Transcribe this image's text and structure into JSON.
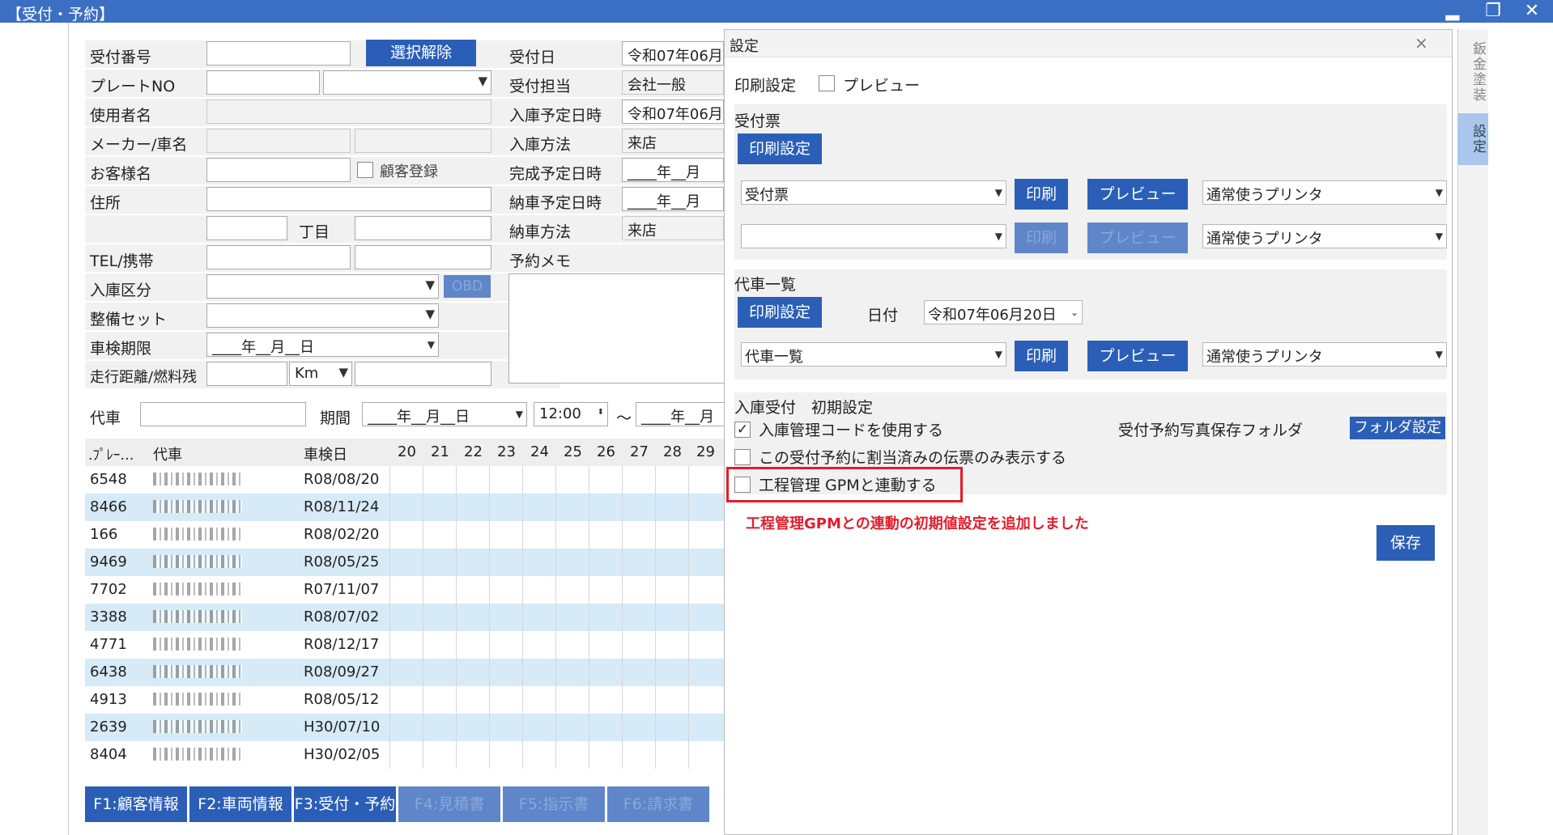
{
  "window": {
    "title": "【受付・予約】",
    "minimize": "▂",
    "restore": "❐",
    "close": "✕"
  },
  "form": {
    "reception_no_label": "受付番号",
    "clear_selection_button": "選択解除",
    "plate_label": "プレートNO",
    "user_label": "使用者名",
    "maker_label": "メーカー/車名",
    "customer_label": "お客様名",
    "customer_register_label": "顧客登録",
    "address_label": "住所",
    "chome_label": "丁目",
    "tel_label": "TEL/携帯",
    "arrival_type_label": "入庫区分",
    "obd_button": "OBD",
    "service_set_label": "整備セット",
    "inspection_label": "車検期限",
    "inspection_value": "____年__月__日",
    "mileage_label": "走行距離/燃料残",
    "mileage_unit": "Km",
    "right": {
      "date_label": "受付日",
      "date_value": "令和07年06月",
      "staff_label": "受付担当",
      "staff_value": "会社一般",
      "arrival_dt_label": "入庫予定日時",
      "arrival_dt_value": "令和07年06月",
      "arrival_method_label": "入庫方法",
      "arrival_method_value": "来店",
      "complete_dt_label": "完成予定日時",
      "complete_dt_value": "____年__月",
      "delivery_dt_label": "納車予定日時",
      "delivery_dt_value": "____年__月",
      "delivery_method_label": "納車方法",
      "delivery_method_value": "来店",
      "memo_label": "予約メモ"
    },
    "loaner_label": "代車",
    "period_label": "期間",
    "period_from": "____年__月__日",
    "period_time": "12:00",
    "period_tilde": "〜",
    "period_to": "____年__月"
  },
  "grid": {
    "headers": {
      "plate": ".ﾌﾟﾚｰ…",
      "car": "代車",
      "inspection": "車検日"
    },
    "days": [
      "20",
      "21",
      "22",
      "23",
      "24",
      "25",
      "26",
      "27",
      "28",
      "29"
    ],
    "rows": [
      {
        "plate": "6548",
        "date": "R08/08/20"
      },
      {
        "plate": "8466",
        "date": "R08/11/24"
      },
      {
        "plate": "166",
        "date": "R08/02/20"
      },
      {
        "plate": "9469",
        "date": "R08/05/25"
      },
      {
        "plate": "7702",
        "date": "R07/11/07"
      },
      {
        "plate": "3388",
        "date": "R08/07/02"
      },
      {
        "plate": "4771",
        "date": "R08/12/17"
      },
      {
        "plate": "6438",
        "date": "R08/09/27"
      },
      {
        "plate": "4913",
        "date": "R08/05/12"
      },
      {
        "plate": "2639",
        "date": "H30/07/10"
      },
      {
        "plate": "8404",
        "date": "H30/02/05"
      }
    ]
  },
  "fkeys": [
    "F1:顧客情報",
    "F2:車両情報",
    "F3:受付・予約",
    "F4:見積書",
    "F5:指示書",
    "F6:請求書"
  ],
  "settings": {
    "title": "設定",
    "close": "×",
    "print_settings_label": "印刷設定",
    "preview_label": "プレビュー",
    "receipt": {
      "title": "受付票",
      "print_settings_button": "印刷設定",
      "doc_select": "受付票",
      "print_button": "印刷",
      "preview_button": "プレビュー",
      "printer_select": "通常使うプリンタ",
      "printer_select_2": "通常使うプリンタ"
    },
    "loaner_list": {
      "title": "代車一覧",
      "print_settings_button": "印刷設定",
      "date_label": "日付",
      "date_value": "令和07年06月20日",
      "doc_select": "代車一覧",
      "print_button": "印刷",
      "preview_button": "プレビュー",
      "printer_select": "通常使うプリンタ"
    },
    "defaults": {
      "title": "入庫受付　初期設定",
      "use_code_label": "入庫管理コードを使用する",
      "only_assigned_label": "この受付予約に割当済みの伝票のみ表示する",
      "gpm_label": "工程管理 GPMと連動する",
      "photo_folder_label": "受付予約写真保存フォルダ",
      "folder_button": "フォルダ設定"
    },
    "note": "工程管理GPMとの連動の初期値設定を追加しました",
    "save_button": "保存"
  },
  "sidetabs": {
    "tab1": "鈑金塗装",
    "tab2": "設定"
  }
}
